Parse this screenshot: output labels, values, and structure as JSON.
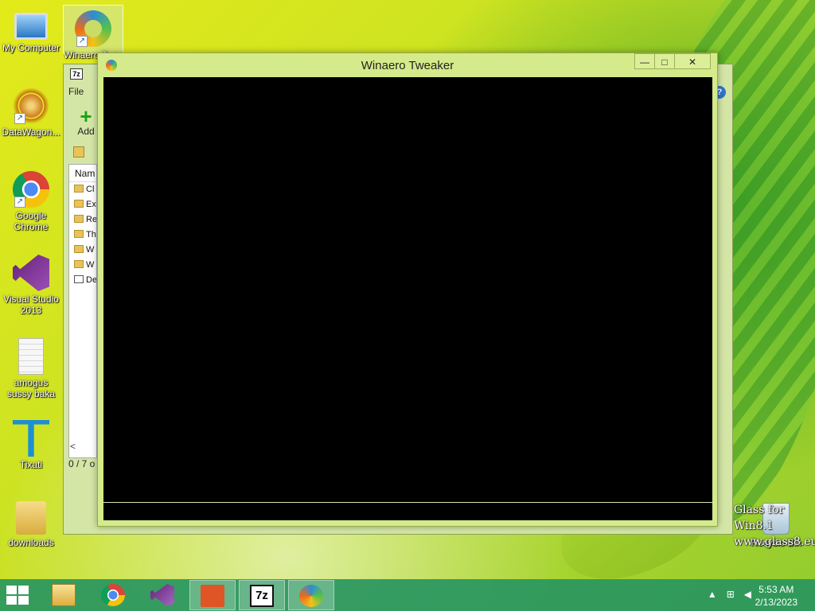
{
  "desktop": {
    "icons": [
      {
        "label": "My Computer",
        "icon": "computer-icon"
      },
      {
        "label": "Winaero Tweaker",
        "icon": "winaero-icon"
      },
      {
        "label": "DataWagon...",
        "icon": "datawagon-icon"
      },
      {
        "label": "Google Chrome",
        "icon": "chrome-icon"
      },
      {
        "label": "Visual Studio 2013",
        "icon": "visual-studio-icon"
      },
      {
        "label": "amogus sussy baka",
        "icon": "text-document-icon"
      },
      {
        "label": "Tixati",
        "icon": "tixati-icon"
      },
      {
        "label": "downloads",
        "icon": "folder-icon"
      },
      {
        "label": "Recycle Bin",
        "icon": "recycle-bin-icon"
      }
    ],
    "watermark": [
      "Glass for Win8.1",
      "www.glass8.eu"
    ]
  },
  "sevenzip": {
    "title_icon": "7z",
    "menu_file": "File",
    "add_label": "Add",
    "column_name": "Nam",
    "rows": [
      "Cl",
      "Ex",
      "Re",
      "Th",
      "W",
      "W",
      "De"
    ],
    "status": "0 / 7 o",
    "scroll_left": "<",
    "help": "?"
  },
  "winaero": {
    "title": "Winaero Tweaker",
    "minimize": "—",
    "maximize": "□",
    "close": "✕"
  },
  "taskbar": {
    "items": [
      "file-explorer",
      "google-chrome",
      "visual-studio",
      "people",
      "7-zip",
      "winaero-tweaker"
    ],
    "active": "winaero-tweaker",
    "tray_up": "▲",
    "time": "5:53 AM",
    "date": "2/13/2023"
  }
}
